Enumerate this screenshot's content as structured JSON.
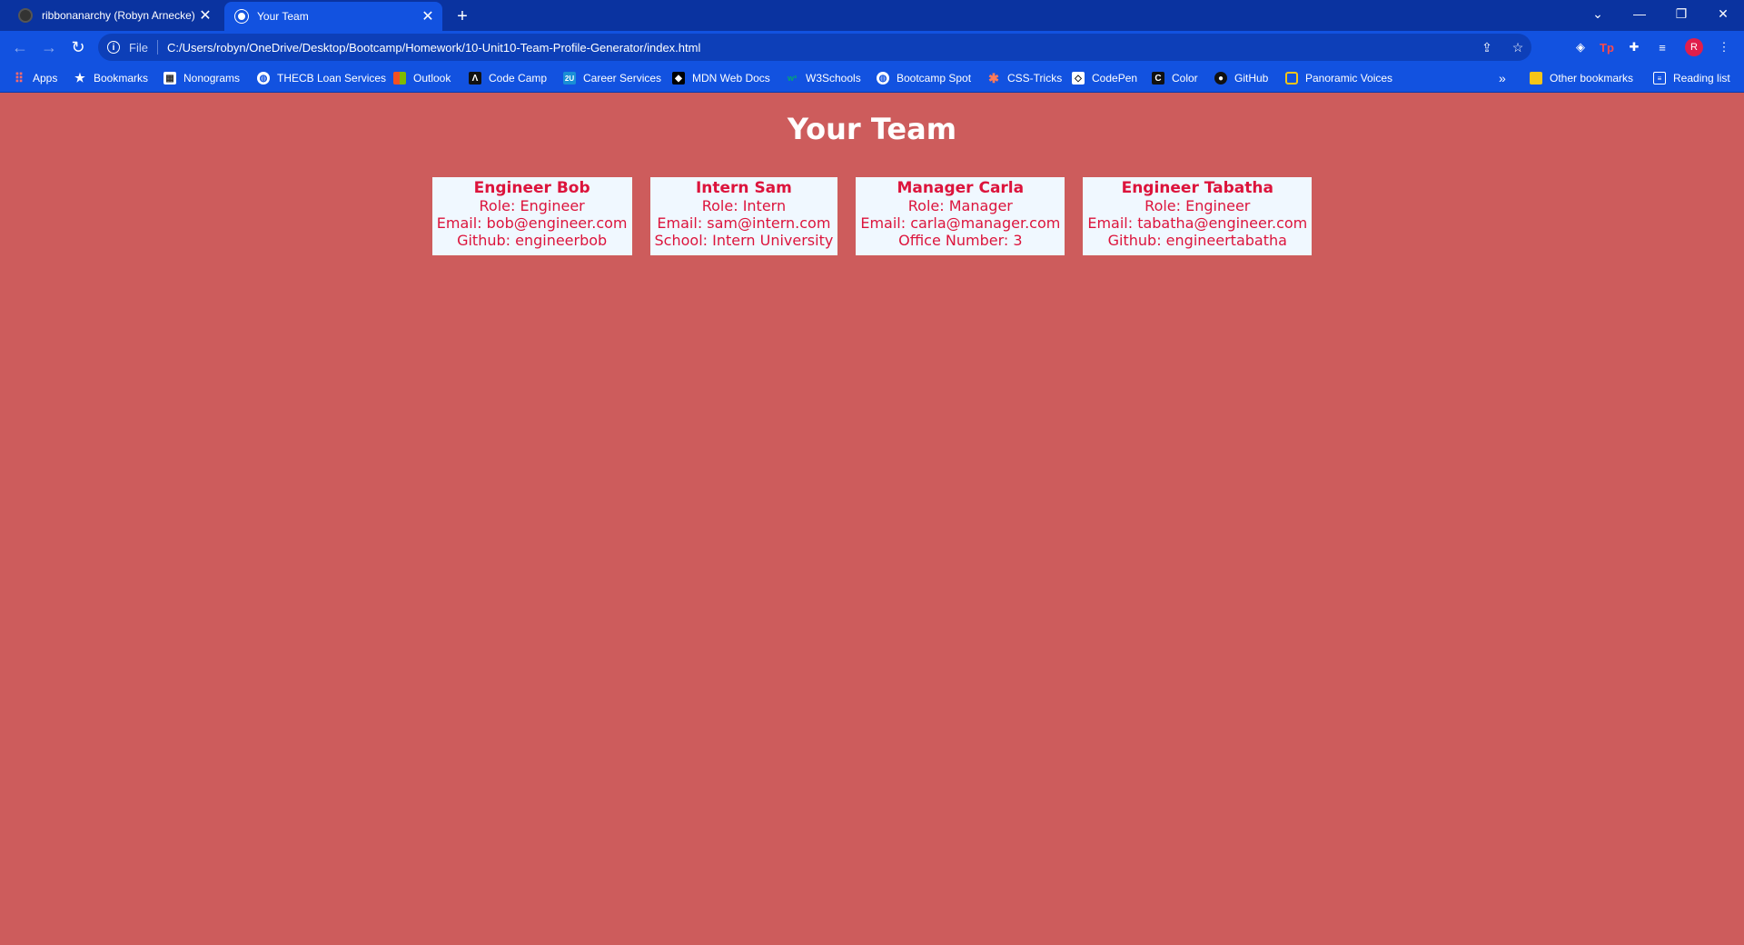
{
  "browser": {
    "tabs": [
      {
        "title": "ribbonanarchy (Robyn Arnecke)"
      },
      {
        "title": "Your Team"
      }
    ],
    "address": {
      "scheme": "File",
      "url": "C:/Users/robyn/OneDrive/Desktop/Bootcamp/Homework/10-Unit10-Team-Profile-Generator/index.html"
    },
    "profile_initial": "R",
    "bookmarks": [
      {
        "label": "Apps",
        "icon": "apps-grid-icon"
      },
      {
        "label": "Bookmarks",
        "icon": "star-icon"
      },
      {
        "label": "Nonograms",
        "icon": "nonograms-icon"
      },
      {
        "label": "THECB Loan Services",
        "icon": "globe-icon"
      },
      {
        "label": "Outlook",
        "icon": "microsoft-icon"
      },
      {
        "label": "Code Camp",
        "icon": "code-camp-icon"
      },
      {
        "label": "Career Services",
        "icon": "2u-icon"
      },
      {
        "label": "MDN Web Docs",
        "icon": "mdn-icon"
      },
      {
        "label": "W3Schools",
        "icon": "w3schools-icon"
      },
      {
        "label": "Bootcamp Spot",
        "icon": "globe-icon"
      },
      {
        "label": "CSS-Tricks",
        "icon": "css-tricks-icon"
      },
      {
        "label": "CodePen",
        "icon": "codepen-icon"
      },
      {
        "label": "Color",
        "icon": "color-icon"
      },
      {
        "label": "GitHub",
        "icon": "github-icon"
      },
      {
        "label": "Panoramic Voices",
        "icon": "panoramic-icon"
      }
    ],
    "bookmarks_overflow": "»",
    "other_bookmarks": "Other bookmarks",
    "reading_list": "Reading list",
    "colors": {
      "tabstrip": "#0a33a0",
      "toolbar": "#1252e0"
    }
  },
  "page": {
    "title": "Your Team",
    "background": "#cd5c5c",
    "card_background": "#f0f8ff",
    "card_text_color": "#dc143c",
    "cards": [
      {
        "name": "Engineer Bob",
        "role": "Role: Engineer",
        "email": "Email: bob@engineer.com",
        "extra": "Github: engineerbob"
      },
      {
        "name": "Intern Sam",
        "role": "Role: Intern",
        "email": "Email: sam@intern.com",
        "extra": "School: Intern University"
      },
      {
        "name": "Manager Carla",
        "role": "Role: Manager",
        "email": "Email: carla@manager.com",
        "extra": "Office Number: 3"
      },
      {
        "name": "Engineer Tabatha",
        "role": "Role: Engineer",
        "email": "Email: tabatha@engineer.com",
        "extra": "Github: engineertabatha"
      }
    ]
  }
}
